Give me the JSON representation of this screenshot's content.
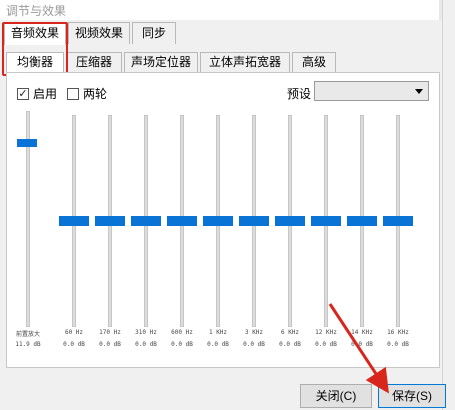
{
  "window": {
    "title": "调节与效果"
  },
  "tabs_primary": [
    {
      "label": "音频效果",
      "active": true
    },
    {
      "label": "视频效果",
      "active": false
    },
    {
      "label": "同步",
      "active": false
    }
  ],
  "tabs_secondary": [
    {
      "label": "均衡器",
      "active": true
    },
    {
      "label": "压缩器",
      "active": false
    },
    {
      "label": "声场定位器",
      "active": false
    },
    {
      "label": "立体声拓宽器",
      "active": false
    },
    {
      "label": "高级",
      "active": false
    }
  ],
  "equalizer": {
    "enable_label": "启用",
    "enable_checked": true,
    "twopass_label": "两轮",
    "twopass_checked": false,
    "preset_label": "预设",
    "preset_value": "",
    "preamp": {
      "label": "前置放大",
      "gain": "11.9 dB",
      "level": 0.85
    },
    "bands": [
      {
        "freq": "60 Hz",
        "gain": "0.0 dB",
        "level": 0.5
      },
      {
        "freq": "170 Hz",
        "gain": "0.0 dB",
        "level": 0.5
      },
      {
        "freq": "310 Hz",
        "gain": "0.0 dB",
        "level": 0.5
      },
      {
        "freq": "600 Hz",
        "gain": "0.0 dB",
        "level": 0.5
      },
      {
        "freq": "1 KHz",
        "gain": "0.0 dB",
        "level": 0.5
      },
      {
        "freq": "3 KHz",
        "gain": "0.0 dB",
        "level": 0.5
      },
      {
        "freq": "6 KHz",
        "gain": "0.0 dB",
        "level": 0.5
      },
      {
        "freq": "12 KHz",
        "gain": "0.0 dB",
        "level": 0.5
      },
      {
        "freq": "14 KHz",
        "gain": "0.0 dB",
        "level": 0.5
      },
      {
        "freq": "16 KHz",
        "gain": "0.0 dB",
        "level": 0.5
      }
    ]
  },
  "buttons": {
    "close_label": "关闭(C)",
    "save_label": "保存(S)"
  },
  "colors": {
    "accent": "#0a74d6",
    "annotation": "#d9261c"
  }
}
